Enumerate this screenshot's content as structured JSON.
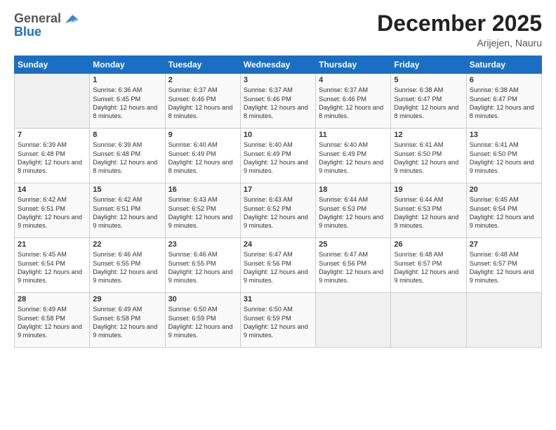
{
  "logo": {
    "general": "General",
    "blue": "Blue"
  },
  "header": {
    "title": "December 2025",
    "location": "Arijejen, Nauru"
  },
  "weekdays": [
    "Sunday",
    "Monday",
    "Tuesday",
    "Wednesday",
    "Thursday",
    "Friday",
    "Saturday"
  ],
  "weeks": [
    [
      {
        "day": "",
        "sunrise": "",
        "sunset": "",
        "daylight": "",
        "empty": true
      },
      {
        "day": "1",
        "sunrise": "Sunrise: 6:36 AM",
        "sunset": "Sunset: 6:45 PM",
        "daylight": "Daylight: 12 hours and 8 minutes."
      },
      {
        "day": "2",
        "sunrise": "Sunrise: 6:37 AM",
        "sunset": "Sunset: 6:46 PM",
        "daylight": "Daylight: 12 hours and 8 minutes."
      },
      {
        "day": "3",
        "sunrise": "Sunrise: 6:37 AM",
        "sunset": "Sunset: 6:46 PM",
        "daylight": "Daylight: 12 hours and 8 minutes."
      },
      {
        "day": "4",
        "sunrise": "Sunrise: 6:37 AM",
        "sunset": "Sunset: 6:46 PM",
        "daylight": "Daylight: 12 hours and 8 minutes."
      },
      {
        "day": "5",
        "sunrise": "Sunrise: 6:38 AM",
        "sunset": "Sunset: 6:47 PM",
        "daylight": "Daylight: 12 hours and 8 minutes."
      },
      {
        "day": "6",
        "sunrise": "Sunrise: 6:38 AM",
        "sunset": "Sunset: 6:47 PM",
        "daylight": "Daylight: 12 hours and 8 minutes."
      }
    ],
    [
      {
        "day": "7",
        "sunrise": "Sunrise: 6:39 AM",
        "sunset": "Sunset: 6:48 PM",
        "daylight": "Daylight: 12 hours and 8 minutes."
      },
      {
        "day": "8",
        "sunrise": "Sunrise: 6:39 AM",
        "sunset": "Sunset: 6:48 PM",
        "daylight": "Daylight: 12 hours and 8 minutes."
      },
      {
        "day": "9",
        "sunrise": "Sunrise: 6:40 AM",
        "sunset": "Sunset: 6:49 PM",
        "daylight": "Daylight: 12 hours and 8 minutes."
      },
      {
        "day": "10",
        "sunrise": "Sunrise: 6:40 AM",
        "sunset": "Sunset: 6:49 PM",
        "daylight": "Daylight: 12 hours and 9 minutes."
      },
      {
        "day": "11",
        "sunrise": "Sunrise: 6:40 AM",
        "sunset": "Sunset: 6:49 PM",
        "daylight": "Daylight: 12 hours and 9 minutes."
      },
      {
        "day": "12",
        "sunrise": "Sunrise: 6:41 AM",
        "sunset": "Sunset: 6:50 PM",
        "daylight": "Daylight: 12 hours and 9 minutes."
      },
      {
        "day": "13",
        "sunrise": "Sunrise: 6:41 AM",
        "sunset": "Sunset: 6:50 PM",
        "daylight": "Daylight: 12 hours and 9 minutes."
      }
    ],
    [
      {
        "day": "14",
        "sunrise": "Sunrise: 6:42 AM",
        "sunset": "Sunset: 6:51 PM",
        "daylight": "Daylight: 12 hours and 9 minutes."
      },
      {
        "day": "15",
        "sunrise": "Sunrise: 6:42 AM",
        "sunset": "Sunset: 6:51 PM",
        "daylight": "Daylight: 12 hours and 9 minutes."
      },
      {
        "day": "16",
        "sunrise": "Sunrise: 6:43 AM",
        "sunset": "Sunset: 6:52 PM",
        "daylight": "Daylight: 12 hours and 9 minutes."
      },
      {
        "day": "17",
        "sunrise": "Sunrise: 6:43 AM",
        "sunset": "Sunset: 6:52 PM",
        "daylight": "Daylight: 12 hours and 9 minutes."
      },
      {
        "day": "18",
        "sunrise": "Sunrise: 6:44 AM",
        "sunset": "Sunset: 6:53 PM",
        "daylight": "Daylight: 12 hours and 9 minutes."
      },
      {
        "day": "19",
        "sunrise": "Sunrise: 6:44 AM",
        "sunset": "Sunset: 6:53 PM",
        "daylight": "Daylight: 12 hours and 9 minutes."
      },
      {
        "day": "20",
        "sunrise": "Sunrise: 6:45 AM",
        "sunset": "Sunset: 6:54 PM",
        "daylight": "Daylight: 12 hours and 9 minutes."
      }
    ],
    [
      {
        "day": "21",
        "sunrise": "Sunrise: 6:45 AM",
        "sunset": "Sunset: 6:54 PM",
        "daylight": "Daylight: 12 hours and 9 minutes."
      },
      {
        "day": "22",
        "sunrise": "Sunrise: 6:46 AM",
        "sunset": "Sunset: 6:55 PM",
        "daylight": "Daylight: 12 hours and 9 minutes."
      },
      {
        "day": "23",
        "sunrise": "Sunrise: 6:46 AM",
        "sunset": "Sunset: 6:55 PM",
        "daylight": "Daylight: 12 hours and 9 minutes."
      },
      {
        "day": "24",
        "sunrise": "Sunrise: 6:47 AM",
        "sunset": "Sunset: 6:56 PM",
        "daylight": "Daylight: 12 hours and 9 minutes."
      },
      {
        "day": "25",
        "sunrise": "Sunrise: 6:47 AM",
        "sunset": "Sunset: 6:56 PM",
        "daylight": "Daylight: 12 hours and 9 minutes."
      },
      {
        "day": "26",
        "sunrise": "Sunrise: 6:48 AM",
        "sunset": "Sunset: 6:57 PM",
        "daylight": "Daylight: 12 hours and 9 minutes."
      },
      {
        "day": "27",
        "sunrise": "Sunrise: 6:48 AM",
        "sunset": "Sunset: 6:57 PM",
        "daylight": "Daylight: 12 hours and 9 minutes."
      }
    ],
    [
      {
        "day": "28",
        "sunrise": "Sunrise: 6:49 AM",
        "sunset": "Sunset: 6:58 PM",
        "daylight": "Daylight: 12 hours and 9 minutes."
      },
      {
        "day": "29",
        "sunrise": "Sunrise: 6:49 AM",
        "sunset": "Sunset: 6:58 PM",
        "daylight": "Daylight: 12 hours and 9 minutes."
      },
      {
        "day": "30",
        "sunrise": "Sunrise: 6:50 AM",
        "sunset": "Sunset: 6:59 PM",
        "daylight": "Daylight: 12 hours and 9 minutes."
      },
      {
        "day": "31",
        "sunrise": "Sunrise: 6:50 AM",
        "sunset": "Sunset: 6:59 PM",
        "daylight": "Daylight: 12 hours and 9 minutes."
      },
      {
        "day": "",
        "sunrise": "",
        "sunset": "",
        "daylight": "",
        "empty": true
      },
      {
        "day": "",
        "sunrise": "",
        "sunset": "",
        "daylight": "",
        "empty": true
      },
      {
        "day": "",
        "sunrise": "",
        "sunset": "",
        "daylight": "",
        "empty": true
      }
    ]
  ]
}
